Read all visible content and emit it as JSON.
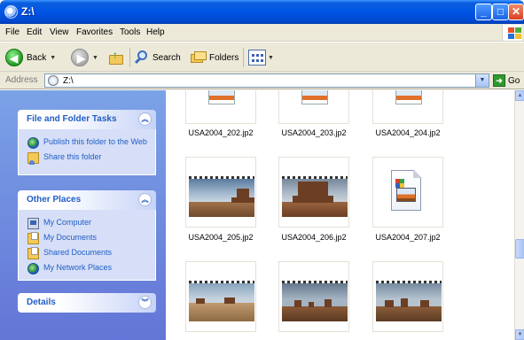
{
  "window": {
    "title": "Z:\\"
  },
  "menu": [
    "File",
    "Edit",
    "View",
    "Favorites",
    "Tools",
    "Help"
  ],
  "toolbar": {
    "back_label": "Back",
    "search_label": "Search",
    "folders_label": "Folders"
  },
  "address": {
    "label": "Address",
    "value": "Z:\\",
    "go_label": "Go"
  },
  "taskpane": {
    "file_tasks": {
      "title": "File and Folder Tasks",
      "items": [
        "Publish this folder to the Web",
        "Share this folder"
      ]
    },
    "other_places": {
      "title": "Other Places",
      "items": [
        "My Computer",
        "My Documents",
        "Shared Documents",
        "My Network Places"
      ]
    },
    "details": {
      "title": "Details"
    }
  },
  "files": [
    "USA2004_202.jp2",
    "USA2004_203.jp2",
    "USA2004_204.jp2",
    "USA2004_205.jp2",
    "USA2004_206.jp2",
    "USA2004_207.jp2"
  ],
  "colors": {
    "titlebar": "#0055e5",
    "taskpane": "#7ba2e7",
    "task_link": "#215dc6"
  }
}
